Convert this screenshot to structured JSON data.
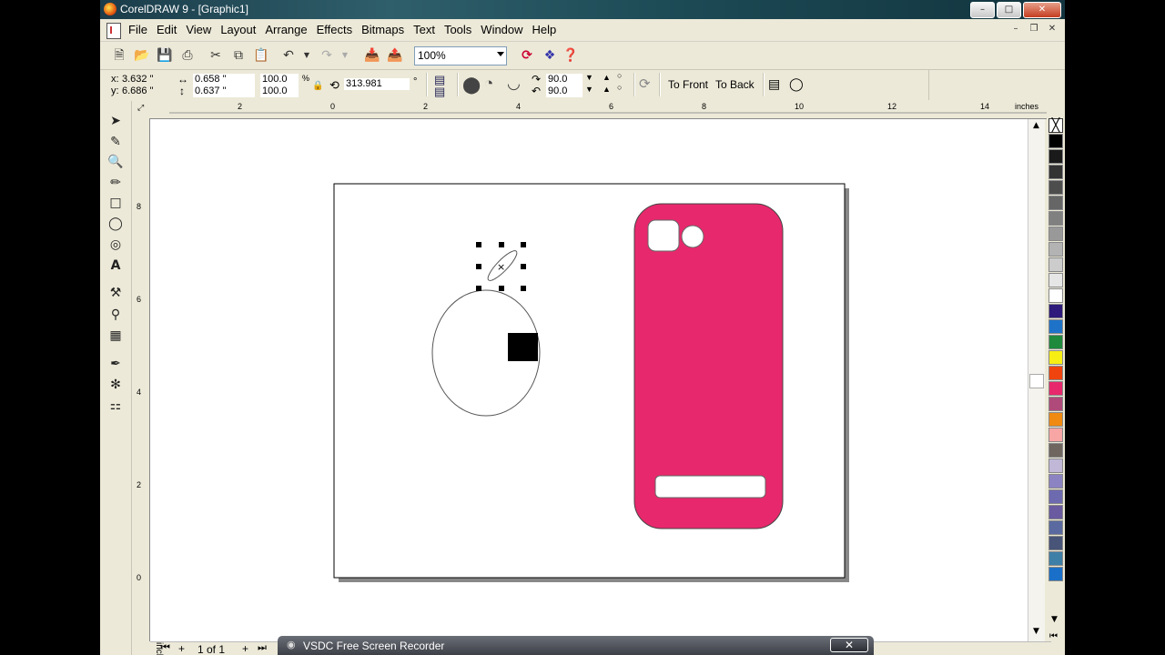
{
  "window": {
    "title": "CorelDRAW 9 - [Graphic1]",
    "min": "–",
    "max": "□",
    "close": "✕"
  },
  "menu": {
    "items": [
      "File",
      "Edit",
      "View",
      "Layout",
      "Arrange",
      "Effects",
      "Bitmaps",
      "Text",
      "Tools",
      "Window",
      "Help"
    ]
  },
  "mdi": {
    "min": "–",
    "restore": "❐",
    "close": "✕"
  },
  "toolbar": {
    "zoom": "100%"
  },
  "property_bar": {
    "x_label": "x:",
    "x": "3.632 \"",
    "y_label": "y:",
    "y": "6.686 \"",
    "w": "0.658 \"",
    "h": "0.637 \"",
    "scale_x": "100.0",
    "scale_y": "100.0",
    "pct": "%",
    "rotation": "313.981",
    "deg": "°",
    "start_angle": "90.0",
    "end_angle": "90.0",
    "to_front": "To Front",
    "to_back": "To Back"
  },
  "ruler": {
    "unit": "inches",
    "h_ticks": [
      "2",
      "0",
      "2",
      "4",
      "6",
      "8",
      "10",
      "12",
      "14"
    ],
    "v_ticks": [
      "8",
      "6",
      "4",
      "2",
      "0"
    ]
  },
  "status": {
    "page": "1 of 1"
  },
  "recorder": {
    "label": "VSDC Free Screen Recorder",
    "close": "✕"
  },
  "palette": [
    "#000000",
    "#1a1a1a",
    "#333333",
    "#4d4d4d",
    "#666666",
    "#808080",
    "#999999",
    "#b3b3b3",
    "#cccccc",
    "#e6e6e6",
    "#ffffff",
    "#2e1a7a",
    "#1e73c8",
    "#1f8a3c",
    "#f7ee14",
    "#f0440e",
    "#e8286c",
    "#b04a7a",
    "#f08a10",
    "#f7a5a5",
    "#6f6660",
    "#c1b8d8",
    "#8c83c3",
    "#6e6ab0",
    "#6a5aa0",
    "#5a6aa0",
    "#485478",
    "#3e7fa8",
    "#1a70c8"
  ],
  "colors": {
    "accent_pink": "#e8286c"
  }
}
